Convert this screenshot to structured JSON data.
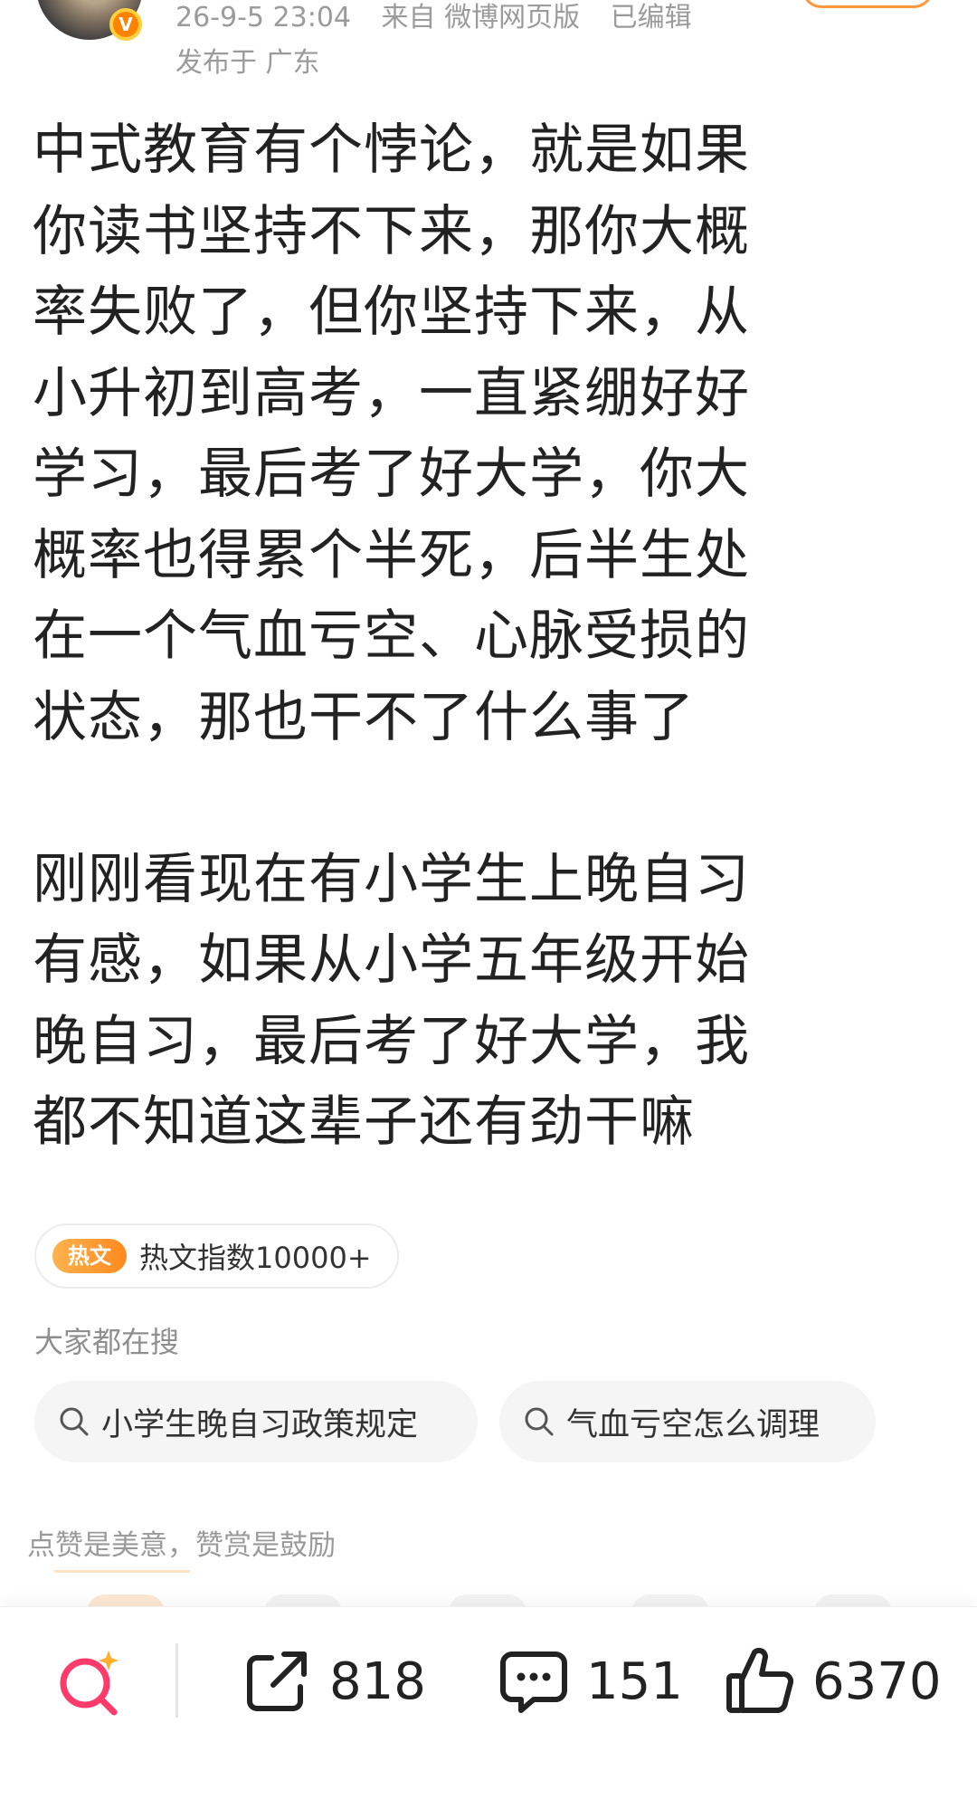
{
  "header": {
    "timestamp": "26-9-5 23:04",
    "source": "来自 微博网页版",
    "edited": "已编辑",
    "location": "发布于 广东",
    "verified_badge": "V"
  },
  "post": {
    "paragraphs": [
      "中式教育有个悖论，就是如果\n你读书坚持不下来，那你大概\n率失败了，但你坚持下来，从\n小升初到高考，一直紧绷好好\n学习，最后考了好大学，你大\n概率也得累个半死，后半生处\n在一个气血亏空、心脉受损的\n状态，那也干不了什么事了",
      "刚刚看现在有小学生上晚自习\n有感，如果从小学五年级开始\n晚自习，最后考了好大学，我\n都不知道这辈子还有劲干嘛"
    ]
  },
  "hot": {
    "badge": "热文",
    "text": "热文指数10000+"
  },
  "search": {
    "heading": "大家都在搜",
    "chips": [
      "小学生晚自习政策规定",
      "气血亏空怎么调理"
    ]
  },
  "reward": {
    "hint": "点赞是美意，赞赏是鼓励"
  },
  "actions": {
    "repost_count": "818",
    "comment_count": "151",
    "like_count": "6370"
  },
  "colors": {
    "accent_orange": "#ff8200",
    "ai_icon_pink": "#ff3b6b",
    "text_gray": "#9b9b9b"
  },
  "icons": [
    "ai-search-icon",
    "repost-icon",
    "comment-icon",
    "like-icon",
    "search-icon"
  ]
}
